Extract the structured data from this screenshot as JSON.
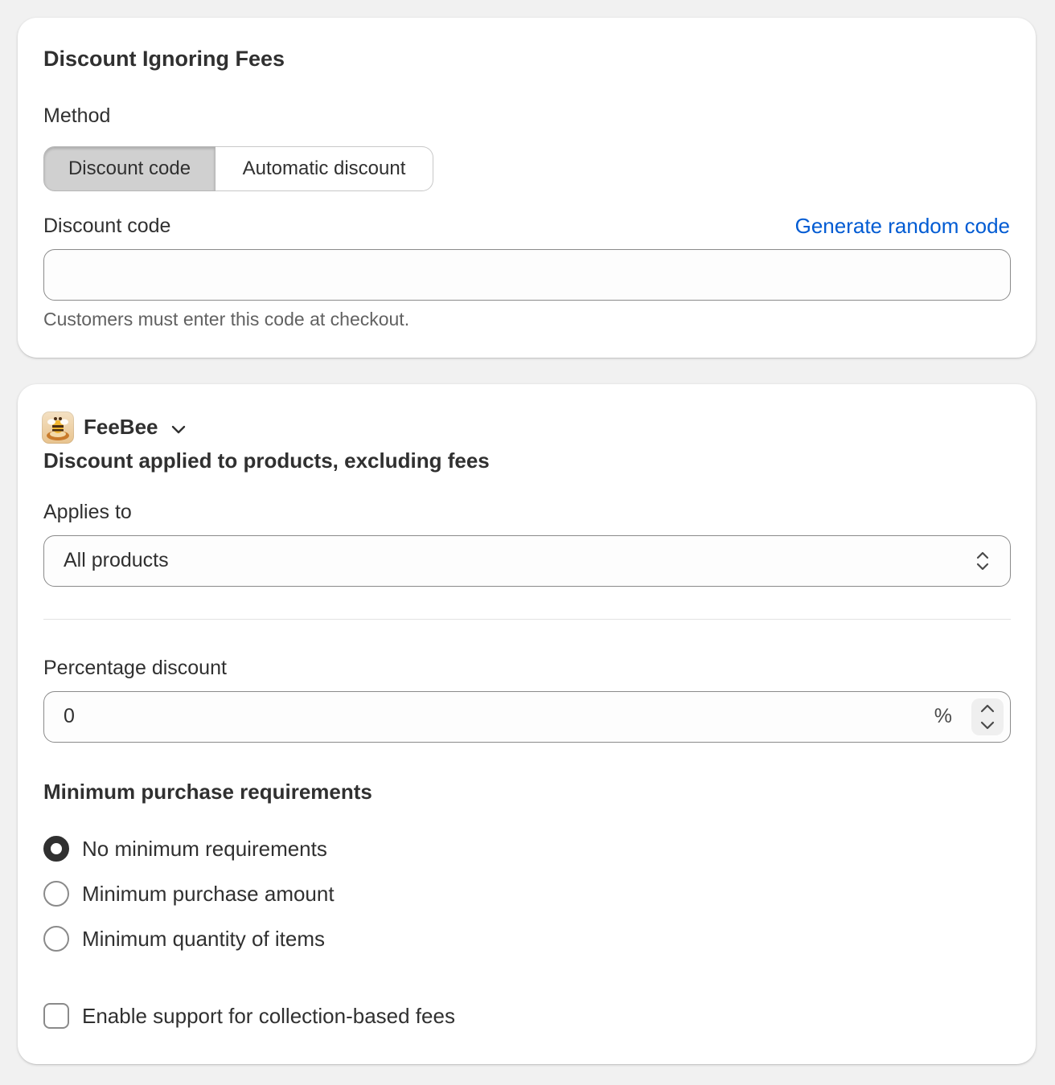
{
  "section1": {
    "title": "Discount Ignoring Fees",
    "method_label": "Method",
    "method_options": [
      "Discount code",
      "Automatic discount"
    ],
    "method_selected": "Discount code",
    "code_label": "Discount code",
    "generate_link": "Generate random code",
    "code_value": "",
    "code_help": "Customers must enter this code at checkout."
  },
  "section2": {
    "app_name": "FeeBee",
    "subtitle": "Discount applied to products, excluding fees",
    "applies_label": "Applies to",
    "applies_value": "All products",
    "percentage_label": "Percentage discount",
    "percentage_value": "0",
    "percentage_suffix": "%",
    "min_title": "Minimum purchase requirements",
    "min_options": [
      "No minimum requirements",
      "Minimum purchase amount",
      "Minimum quantity of items"
    ],
    "min_selected_index": 0,
    "checkbox_label": "Enable support for collection-based fees",
    "checkbox_checked": false
  },
  "colors": {
    "accent_link": "#005bd3",
    "text": "#303030",
    "muted": "#616161",
    "border": "#8a8a8a",
    "background": "#f1f1f1"
  },
  "icons": [
    "bee-app-icon",
    "chevron-down-icon",
    "select-arrows-icon",
    "stepper-up-icon",
    "stepper-down-icon"
  ]
}
